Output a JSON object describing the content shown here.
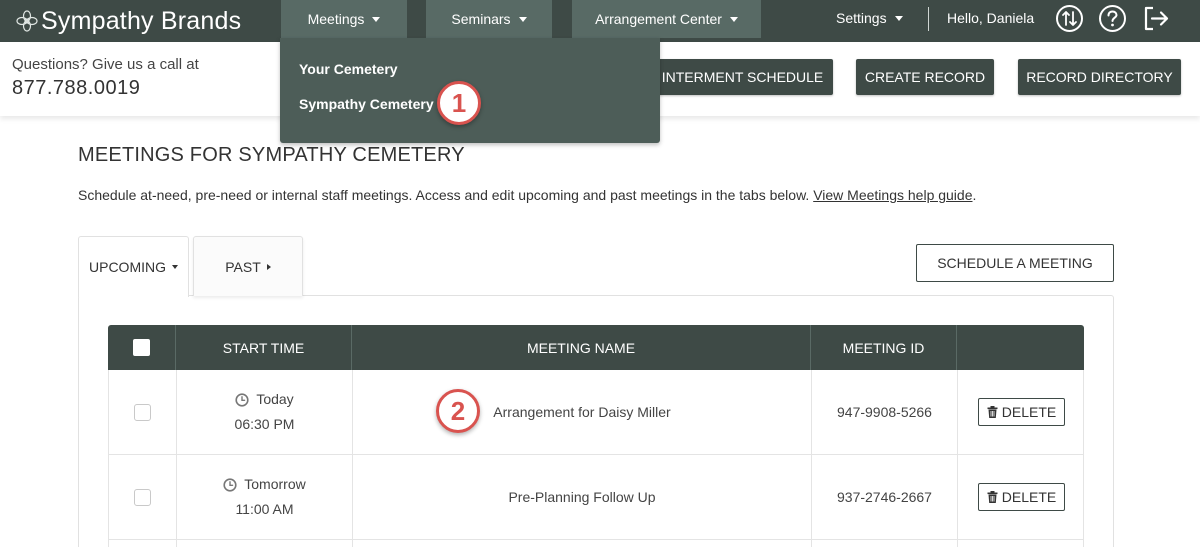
{
  "brand": {
    "name": "Sympathy Brands",
    "icon": "flower-logo-icon"
  },
  "nav": {
    "meetings": "Meetings",
    "seminars": "Seminars",
    "arrangement": "Arrangement Center",
    "settings": "Settings",
    "greeting": "Hello, Daniela",
    "icons": [
      "swap-arrows-icon",
      "help-icon",
      "logout-icon"
    ]
  },
  "dropdown": {
    "items": [
      "Your Cemetery",
      "Sympathy Cemetery"
    ]
  },
  "subheader": {
    "question": "Questions? Give us a call at",
    "phone": "877.788.0019",
    "buttons": [
      "INTERMENT SCHEDULE",
      "CREATE RECORD",
      "RECORD DIRECTORY"
    ]
  },
  "page": {
    "title": "MEETINGS FOR SYMPATHY CEMETERY",
    "description": "Schedule at-need, pre-need or internal staff meetings. Access and edit upcoming and past meetings in the tabs below. ",
    "help_link": "View Meetings help guide",
    "help_link_suffix": "."
  },
  "tabs": {
    "upcoming": "UPCOMING",
    "past": "PAST"
  },
  "schedule_button": "SCHEDULE A MEETING",
  "table": {
    "headers": [
      "START TIME",
      "MEETING NAME",
      "MEETING ID"
    ],
    "rows": [
      {
        "day": "Today",
        "time": "06:30 PM",
        "name": "Arrangement for Daisy Miller",
        "id": "947-9908-5266",
        "action": "DELETE"
      },
      {
        "day": "Tomorrow",
        "time": "11:00 AM",
        "name": "Pre-Planning Follow Up",
        "id": "937-2746-2667",
        "action": "DELETE"
      }
    ]
  },
  "markers": [
    "1",
    "2"
  ],
  "colors": {
    "primary": "#3e4a46",
    "nav_tab": "#586a65",
    "dropdown": "#4d5d58",
    "marker": "#d9534f"
  }
}
